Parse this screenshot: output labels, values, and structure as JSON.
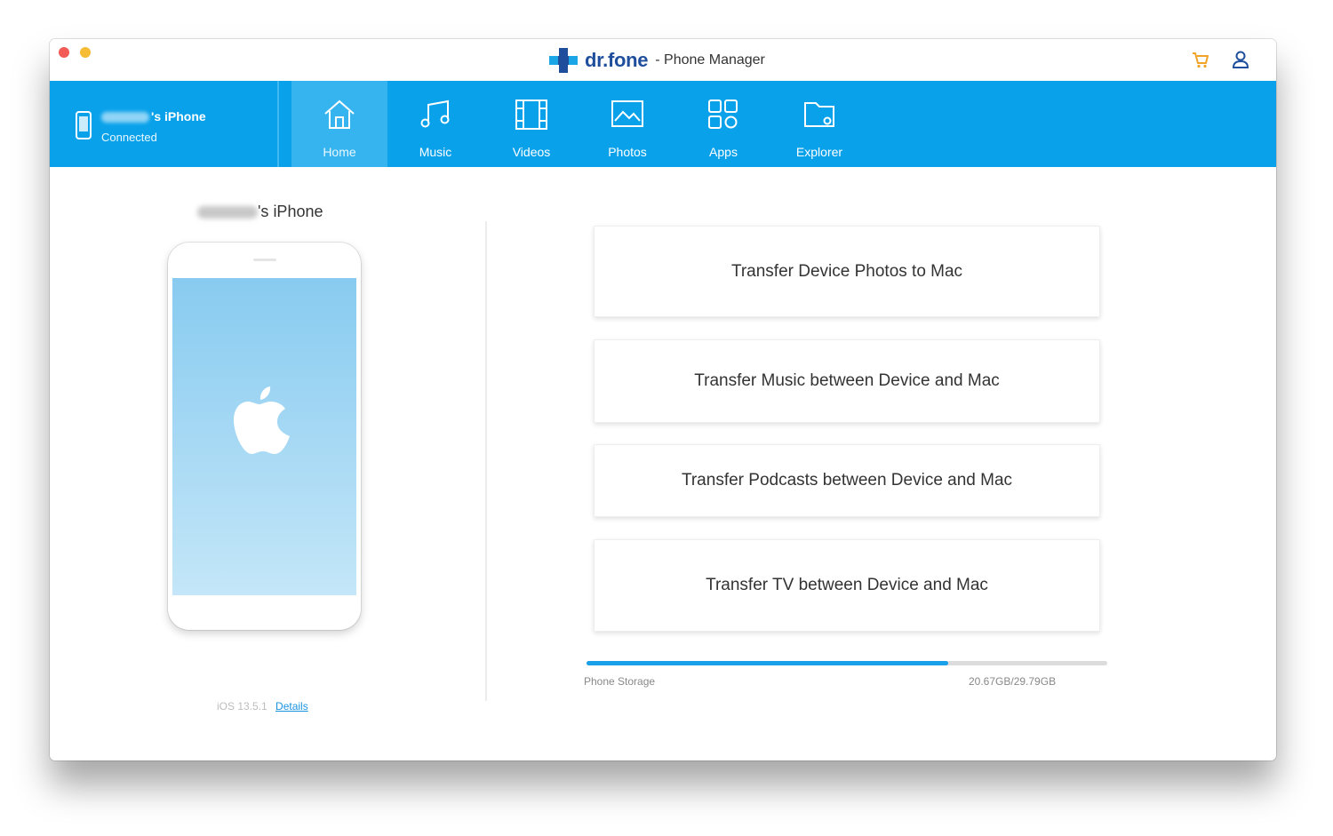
{
  "window": {
    "brand_name": "dr.fone",
    "brand_subtitle": "- Phone Manager"
  },
  "device": {
    "name_suffix": "'s iPhone",
    "status": "Connected",
    "os_version": "iOS 13.5.1",
    "details_link": "Details"
  },
  "tabs": [
    {
      "label": "Home",
      "icon": "home-icon",
      "active": true
    },
    {
      "label": "Music",
      "icon": "music-icon",
      "active": false
    },
    {
      "label": "Videos",
      "icon": "film-icon",
      "active": false
    },
    {
      "label": "Photos",
      "icon": "image-icon",
      "active": false
    },
    {
      "label": "Apps",
      "icon": "apps-grid-icon",
      "active": false
    },
    {
      "label": "Explorer",
      "icon": "folder-icon",
      "active": false
    }
  ],
  "actions": [
    "Transfer Device Photos to Mac",
    "Transfer Music between Device and Mac",
    "Transfer Podcasts between Device and Mac",
    "Transfer TV between Device and Mac"
  ],
  "storage": {
    "label": "Phone Storage",
    "value": "20.67GB/29.79GB",
    "used_fraction": 0.694
  },
  "colors": {
    "nav_blue": "#09a1ea",
    "brand_dark": "#1f4f9c",
    "cart_orange": "#f0a326",
    "link_blue": "#1a94e0"
  }
}
